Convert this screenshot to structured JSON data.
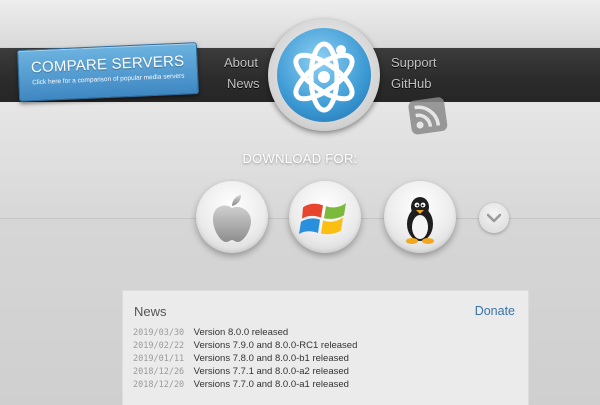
{
  "compare": {
    "title": "COMPARE SERVERS",
    "subtitle": "Click here for a comparison of popular media servers"
  },
  "nav": {
    "about": "About",
    "news": "News",
    "support": "Support",
    "github": "GitHub"
  },
  "download": {
    "label": "DOWNLOAD FOR:",
    "platforms": [
      {
        "name": "macOS",
        "icon": "apple-icon"
      },
      {
        "name": "Windows",
        "icon": "windows-icon"
      },
      {
        "name": "Linux",
        "icon": "tux-icon"
      }
    ]
  },
  "news": {
    "title": "News",
    "donate": "Donate",
    "items": [
      {
        "date": "2019/03/30",
        "text": "Version 8.0.0 released"
      },
      {
        "date": "2019/02/22",
        "text": "Versions 7.9.0 and 8.0.0-RC1 released"
      },
      {
        "date": "2019/01/11",
        "text": "Versions 7.8.0 and 8.0.0-b1 released"
      },
      {
        "date": "2018/12/26",
        "text": "Versions 7.7.1 and 8.0.0-a2 released"
      },
      {
        "date": "2018/12/20",
        "text": "Versions 7.7.0 and 8.0.0-a1 released"
      }
    ]
  },
  "colors": {
    "accent": "#3f87c2",
    "link": "#3a73ab",
    "navbar": "#2b2b2b"
  }
}
